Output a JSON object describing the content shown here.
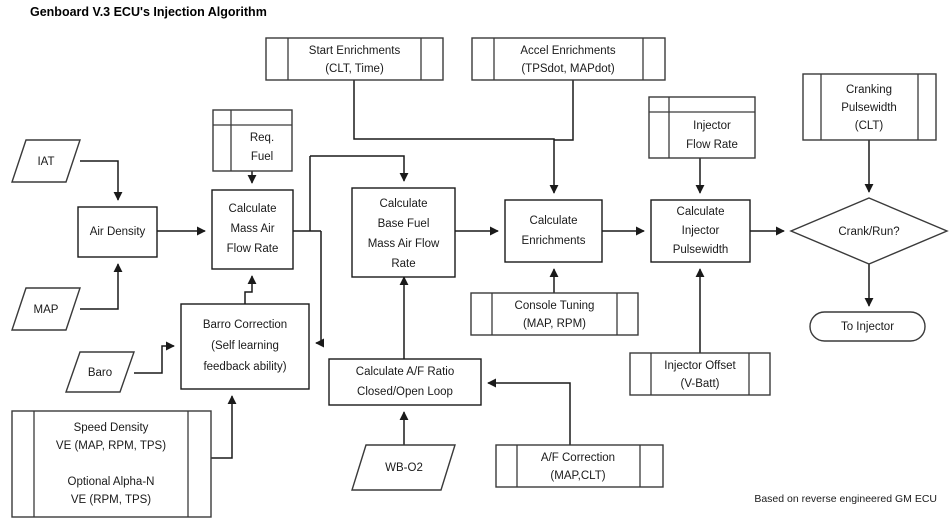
{
  "diagram": {
    "title": "Genboard V.3 ECU's Injection Algorithm",
    "footer": "Based on reverse engineered GM ECU",
    "colors": {
      "background": "#ffffff",
      "stroke": "#1a1a1a",
      "soft_stroke": "#3a3a3a",
      "text": "#1a1a1a"
    }
  },
  "nodes": {
    "iat": {
      "label": "IAT",
      "shape": "parallelogram"
    },
    "map": {
      "label": "MAP",
      "shape": "parallelogram"
    },
    "baro": {
      "label": "Baro",
      "shape": "parallelogram"
    },
    "wb_o2": {
      "label": "WB-O2",
      "shape": "parallelogram"
    },
    "air_density": {
      "label": "Air Density",
      "shape": "process"
    },
    "calc_mass_air": {
      "line1": "Calculate",
      "line2": "Mass Air",
      "line3": "Flow Rate",
      "shape": "process"
    },
    "calc_base_fuel": {
      "line1": "Calculate",
      "line2": "Base Fuel",
      "line3": "Mass Air Flow",
      "line4": "Rate",
      "shape": "process"
    },
    "calc_enrichments": {
      "line1": "Calculate",
      "line2": "Enrichments",
      "shape": "process"
    },
    "calc_injector_pw": {
      "line1": "Calculate",
      "line2": "Injector",
      "line3": "Pulsewidth",
      "shape": "process"
    },
    "barro_correction": {
      "line1": "Barro Correction",
      "line2": "(Self learning",
      "line3": "feedback ability)",
      "shape": "process"
    },
    "calc_af_ratio": {
      "line1": "Calculate A/F Ratio",
      "line2": "Closed/Open Loop",
      "shape": "process"
    },
    "crank_run": {
      "label": "Crank/Run?",
      "shape": "decision"
    },
    "to_injector": {
      "label": "To Injector",
      "shape": "terminator"
    },
    "req_fuel": {
      "line1": "Req.",
      "line2": "Fuel",
      "shape": "table-left-header"
    },
    "injector_flow_rate": {
      "line1": "Injector",
      "line2": "Flow Rate",
      "shape": "table-left-header"
    },
    "start_enrichments": {
      "line1": "Start Enrichments",
      "line2": "(CLT, Time)",
      "shape": "table"
    },
    "accel_enrichments": {
      "line1": "Accel Enrichments",
      "line2": "(TPSdot, MAPdot)",
      "shape": "table"
    },
    "cranking_pulsewidth": {
      "line1": "Cranking",
      "line2": "Pulsewidth",
      "line3": "(CLT)",
      "shape": "table"
    },
    "console_tuning": {
      "line1": "Console Tuning",
      "line2": "(MAP, RPM)",
      "shape": "table"
    },
    "injector_offset": {
      "line1": "Injector Offset",
      "line2": "(V-Batt)",
      "shape": "table"
    },
    "af_correction": {
      "line1": "A/F Correction",
      "line2": "(MAP,CLT)",
      "shape": "table"
    },
    "speed_density": {
      "line1": "Speed Density",
      "line2": "VE (MAP, RPM, TPS)",
      "line3": "Optional Alpha-N",
      "line4": "VE (RPM, TPS)",
      "shape": "table"
    }
  }
}
